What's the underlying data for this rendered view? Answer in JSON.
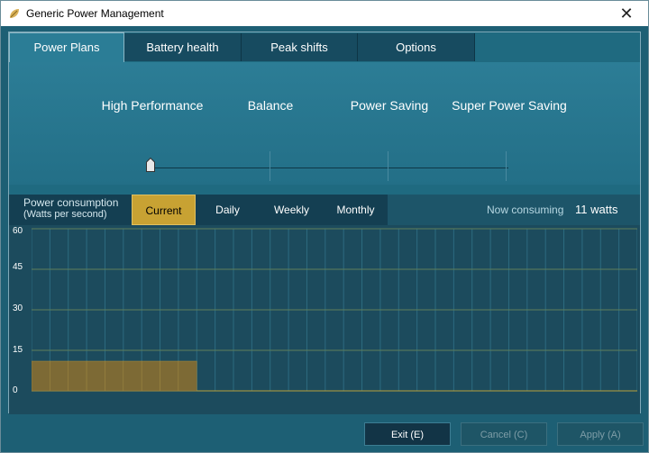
{
  "window": {
    "title": "Generic Power Management",
    "close_glyph": "✕"
  },
  "tabs": [
    {
      "label": "Power Plans",
      "active": true
    },
    {
      "label": "Battery health"
    },
    {
      "label": "Peak shifts"
    },
    {
      "label": "Options"
    }
  ],
  "power_plans": {
    "labels": [
      "High Performance",
      "Balance",
      "Power Saving",
      "Super Power Saving"
    ],
    "selected": "High Performance"
  },
  "consumption": {
    "title": "Power consumption",
    "subtitle": "(Watts per second)",
    "periods": [
      "Current",
      "Daily",
      "Weekly",
      "Monthly"
    ],
    "active_period": "Current",
    "now_label": "Now consuming",
    "now_value": "11 watts"
  },
  "chart_data": {
    "type": "bar",
    "y_ticks": [
      "60",
      "45",
      "30",
      "15",
      "0"
    ],
    "ylim": [
      0,
      60
    ],
    "values": [
      11,
      11,
      11,
      11,
      11,
      11,
      11,
      11,
      11
    ],
    "num_slots": 33,
    "grid": true,
    "bar_color": "#7d6a35",
    "bar_border": "#a08a43",
    "grid_color": "#2d6b80",
    "baseline_color": "#b9a13c"
  },
  "buttons": {
    "exit": "Exit (E)",
    "cancel": "Cancel (C)",
    "apply": "Apply (A)"
  },
  "colors": {
    "accent": "#c8a233",
    "panel": "#1f6a80",
    "dark": "#143f52"
  }
}
